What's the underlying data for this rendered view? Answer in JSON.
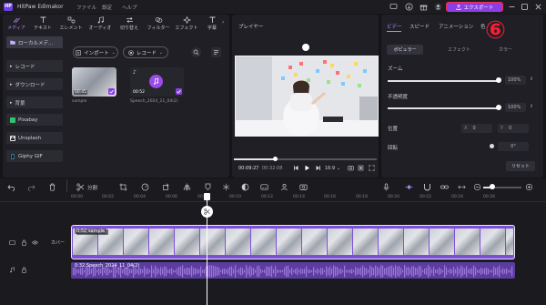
{
  "app": {
    "logo_text": "HP",
    "title": "HitPaw Edimakor"
  },
  "menu": {
    "file": "ファイル",
    "settings": "設定",
    "help": "ヘルプ"
  },
  "export": {
    "label": "エクスポート"
  },
  "annotation": {
    "number": "⑥",
    "color": "#ff1a33"
  },
  "media_tabs": [
    {
      "label": "メディア",
      "icon": "media-icon"
    },
    {
      "label": "テキスト",
      "icon": "text-icon"
    },
    {
      "label": "エレメント",
      "icon": "element-icon"
    },
    {
      "label": "オーディオ",
      "icon": "audio-icon"
    },
    {
      "label": "切り替え",
      "icon": "transition-icon"
    },
    {
      "label": "フィルター",
      "icon": "filter-icon"
    },
    {
      "label": "エフェクト",
      "icon": "effect-icon"
    },
    {
      "label": "字幕",
      "icon": "subtitle-icon"
    }
  ],
  "sidebar": {
    "items": [
      {
        "label": "ローカルメデ..."
      },
      {
        "label": "レコード"
      },
      {
        "label": "ダウンロード"
      },
      {
        "label": "背景"
      },
      {
        "label": "Pixabay"
      },
      {
        "label": "Unsplash"
      },
      {
        "label": "Giphy GIF"
      }
    ]
  },
  "media": {
    "import_label": "インポート",
    "record_label": "レコード",
    "items": [
      {
        "duration": "00:45",
        "name": "sample"
      },
      {
        "duration": "00:52",
        "name": "Speech_2024_11_04(2)"
      }
    ]
  },
  "player": {
    "title": "プレイヤー",
    "current_time": "00:09:27",
    "total_time": "00:32:08",
    "aspect": "16:9",
    "progress": 0.29
  },
  "props": {
    "tabs": [
      "ビデー",
      "スピード",
      "アニメーション",
      "色"
    ],
    "subtabs": {
      "basic": "ボピュラー",
      "effect": "エフェクト",
      "color": "カラー"
    },
    "zoom_label": "ズーム",
    "zoom_value": "100%",
    "opacity_label": "不透明度",
    "opacity_value": "100%",
    "position_label": "位置",
    "pos_x_label": "X",
    "pos_x_value": "0",
    "pos_y_label": "Y",
    "pos_y_value": "0",
    "rotation_label": "回転",
    "rotation_value": "0°",
    "reset_label": "リセット"
  },
  "timeline": {
    "split_label": "分割",
    "ticks": [
      "00:00",
      "00:02",
      "00:04",
      "00:06",
      "00:08",
      "00:10",
      "00:12",
      "00:14",
      "00:16",
      "00:18",
      "00:20",
      "00:22",
      "00:24",
      "00:26"
    ],
    "cover_label": "カバー",
    "video_clip_label": "0:52 sample",
    "audio_clip_label": "0:32 Speech_2024_11_04(2)"
  },
  "colors": {
    "accent": "#8a3fe6",
    "waveform": "#9c75d8",
    "bg": "#151518"
  }
}
